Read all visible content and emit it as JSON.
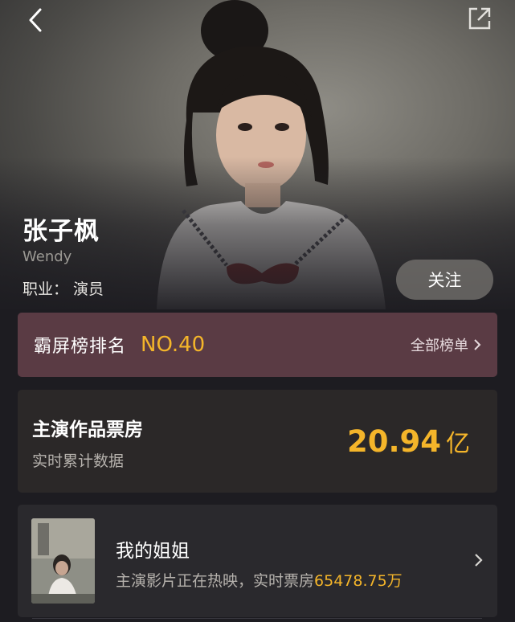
{
  "header": {
    "back_icon": "chevron-left-icon",
    "share_icon": "share-external-icon"
  },
  "profile": {
    "name": "张子枫",
    "english_name": "Wendy",
    "job_label": "职业：",
    "job_value": "演员",
    "follow_label": "关注"
  },
  "ranking": {
    "label": "霸屏榜排名",
    "value": "NO.40",
    "all_label": "全部榜单"
  },
  "box_office": {
    "title": "主演作品票房",
    "subtitle": "实时累计数据",
    "value": "20.94",
    "unit": "亿"
  },
  "movie": {
    "title": "我的姐姐",
    "desc_prefix": "主演影片正在热映，实时票房",
    "desc_value": "65478.75万"
  },
  "colors": {
    "accent": "#f4b52a",
    "background": "#1d1c21",
    "rank_card": "#5a3b44",
    "box_card": "#2b2828"
  }
}
